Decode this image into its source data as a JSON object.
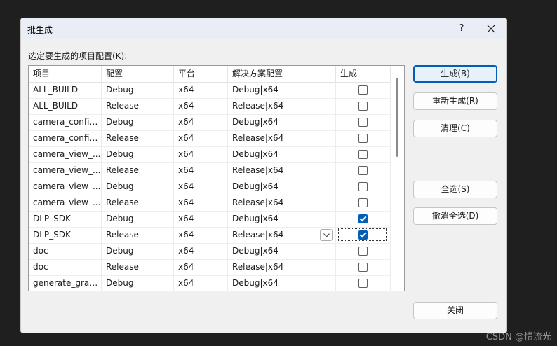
{
  "window": {
    "title": "批生成",
    "help_label": "?"
  },
  "list": {
    "label": "选定要生成的项目配置(K):",
    "columns": [
      "项目",
      "配置",
      "平台",
      "解决方案配置",
      "生成"
    ],
    "rows": [
      {
        "project": "ALL_BUILD",
        "config": "Debug",
        "platform": "x64",
        "solution": "Debug|x64",
        "build": false
      },
      {
        "project": "ALL_BUILD",
        "config": "Release",
        "platform": "x64",
        "solution": "Release|x64",
        "build": false
      },
      {
        "project": "camera_config...",
        "config": "Debug",
        "platform": "x64",
        "solution": "Debug|x64",
        "build": false
      },
      {
        "project": "camera_config...",
        "config": "Release",
        "platform": "x64",
        "solution": "Release|x64",
        "build": false
      },
      {
        "project": "camera_view_...",
        "config": "Debug",
        "platform": "x64",
        "solution": "Debug|x64",
        "build": false
      },
      {
        "project": "camera_view_...",
        "config": "Release",
        "platform": "x64",
        "solution": "Release|x64",
        "build": false
      },
      {
        "project": "camera_view_...",
        "config": "Debug",
        "platform": "x64",
        "solution": "Debug|x64",
        "build": false
      },
      {
        "project": "camera_view_...",
        "config": "Release",
        "platform": "x64",
        "solution": "Release|x64",
        "build": false
      },
      {
        "project": "DLP_SDK",
        "config": "Debug",
        "platform": "x64",
        "solution": "Debug|x64",
        "build": true
      },
      {
        "project": "DLP_SDK",
        "config": "Release",
        "platform": "x64",
        "solution": "Release|x64",
        "build": true
      },
      {
        "project": "doc",
        "config": "Debug",
        "platform": "x64",
        "solution": "Debug|x64",
        "build": false
      },
      {
        "project": "doc",
        "config": "Release",
        "platform": "x64",
        "solution": "Release|x64",
        "build": false
      },
      {
        "project": "generate_gray...",
        "config": "Debug",
        "platform": "x64",
        "solution": "Debug|x64",
        "build": false
      }
    ]
  },
  "buttons": {
    "build": "生成(B)",
    "rebuild": "重新生成(R)",
    "clean": "清理(C)",
    "select_all": "全选(S)",
    "deselect_all": "撤消全选(D)",
    "close": "关闭"
  },
  "watermark": "CSDN @惜流光",
  "colors": {
    "accent": "#005fb8",
    "dialog_bg": "#f0f0f0",
    "title_bg": "#e9edf5"
  }
}
